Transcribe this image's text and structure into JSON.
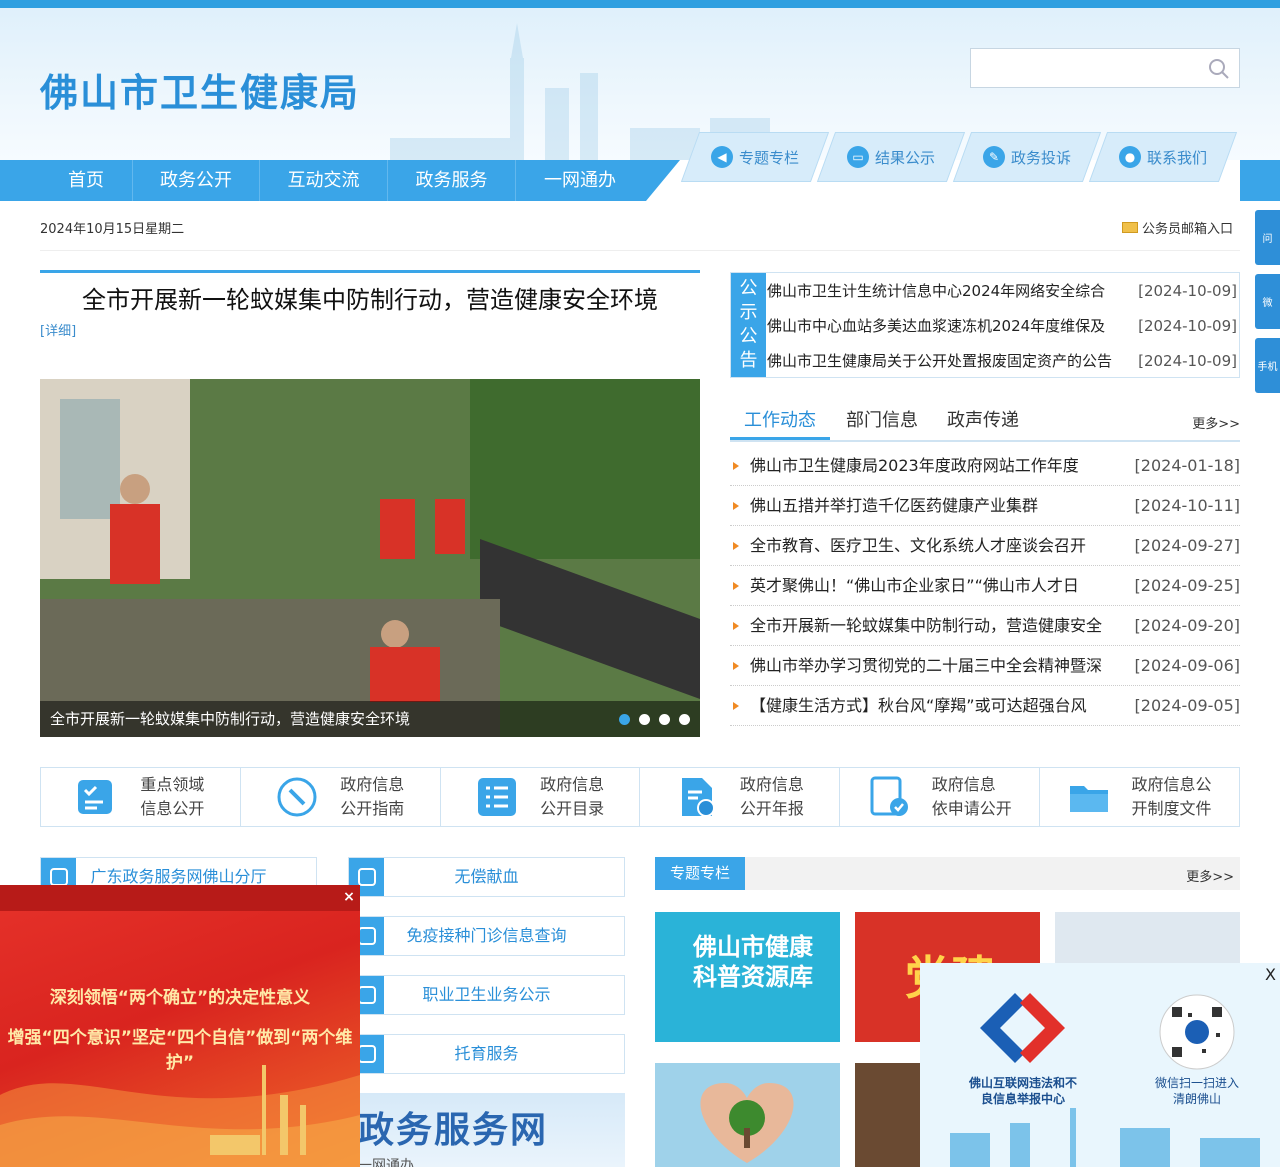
{
  "site": {
    "title": "佛山市卫生健康局"
  },
  "search": {
    "placeholder": ""
  },
  "nav": {
    "items": [
      {
        "label": "首页"
      },
      {
        "label": "政务公开"
      },
      {
        "label": "互动交流"
      },
      {
        "label": "政务服务"
      },
      {
        "label": "一网通办"
      }
    ],
    "tabs": [
      {
        "label": "专题专栏",
        "icon": "speaker-icon"
      },
      {
        "label": "结果公示",
        "icon": "monitor-icon"
      },
      {
        "label": "政务投诉",
        "icon": "pen-icon"
      },
      {
        "label": "联系我们",
        "icon": "chat-icon"
      }
    ]
  },
  "date": "2024年10月15日星期二",
  "mailbox": {
    "label": "公务员邮箱入口"
  },
  "side_float": [
    "问",
    "微",
    "手机"
  ],
  "headline": {
    "title": "全市开展新一轮蚊媒集中防制行动，营造健康安全环境",
    "detail": "[详细]"
  },
  "slider": {
    "caption": "全市开展新一轮蚊媒集中防制行动，营造健康安全环境",
    "dots": 4,
    "active": 1
  },
  "notice": {
    "tag": [
      "公",
      "示",
      "公",
      "告"
    ],
    "items": [
      {
        "title": "佛山市卫生计生统计信息中心2024年网络安全综合",
        "date": "[2024-10-09]"
      },
      {
        "title": "佛山市中心血站多美达血浆速冻机2024年度维保及",
        "date": "[2024-10-09]"
      },
      {
        "title": "佛山市卫生健康局关于公开处置报废固定资产的公告",
        "date": "[2024-10-09]"
      }
    ]
  },
  "news_tabs": {
    "tabs": [
      "工作动态",
      "部门信息",
      "政声传递"
    ],
    "active": 0,
    "more": "更多>>"
  },
  "news": [
    {
      "title": "佛山市卫生健康局2023年度政府网站工作年度",
      "date": "[2024-01-18]"
    },
    {
      "title": "佛山五措并举打造千亿医药健康产业集群",
      "date": "[2024-10-11]"
    },
    {
      "title": "全市教育、医疗卫生、文化系统人才座谈会召开",
      "date": "[2024-09-27]"
    },
    {
      "title": "英才聚佛山！“佛山市企业家日”“佛山市人才日",
      "date": "[2024-09-25]"
    },
    {
      "title": "全市开展新一轮蚊媒集中防制行动，营造健康安全",
      "date": "[2024-09-20]"
    },
    {
      "title": "佛山市举办学习贯彻党的二十届三中全会精神暨深",
      "date": "[2024-09-06]"
    },
    {
      "title": "【健康生活方式】秋台风“摩羯”或可达超强台风",
      "date": "[2024-09-05]"
    }
  ],
  "info_links": [
    {
      "line1": "重点领域",
      "line2": "信息公开",
      "icon": "checklist-icon"
    },
    {
      "line1": "政府信息",
      "line2": "公开指南",
      "icon": "compass-icon"
    },
    {
      "line1": "政府信息",
      "line2": "公开目录",
      "icon": "list-icon"
    },
    {
      "line1": "政府信息",
      "line2": "公开年报",
      "icon": "report-icon"
    },
    {
      "line1": "政府信息",
      "line2": "依申请公开",
      "icon": "form-check-icon"
    },
    {
      "line1": "政府信息公",
      "line2": "开制度文件",
      "icon": "folder-icon"
    }
  ],
  "services": {
    "left": [
      {
        "label": "广东政务服务网佛山分厅"
      }
    ],
    "right": [
      {
        "label": "无偿献血"
      },
      {
        "label": "免疫接种门诊信息查询"
      },
      {
        "label": "职业卫生业务公示"
      },
      {
        "label": "托育服务"
      }
    ]
  },
  "gov_banner": {
    "title": "政务服务网",
    "subtitle": "一网通办"
  },
  "zt": {
    "tag": "专题专栏",
    "more": "更多>>",
    "cards": [
      {
        "text": "佛山市健康科普资源库",
        "color": "#2ab3d8"
      },
      {
        "text": "党建",
        "color": "#d83227"
      },
      {
        "text": "",
        "color": "#dfe8f0"
      },
      {
        "text": "",
        "color": "#7fb85a"
      },
      {
        "text": "",
        "color": "#6a4a32"
      }
    ]
  },
  "popup_left": {
    "line1": "深刻领悟“两个确立”的决定性意义",
    "line2": "增强“四个意识”坚定“四个自信”做到“两个维护”",
    "close": "×"
  },
  "popup_right": {
    "close": "X",
    "caption1": "佛山互联网违法和不良信息举报中心",
    "caption2": "微信扫一扫进入清朗佛山"
  },
  "colors": {
    "brand": "#3aa5e8",
    "title": "#2a8fd8",
    "accent": "#f08a24"
  }
}
